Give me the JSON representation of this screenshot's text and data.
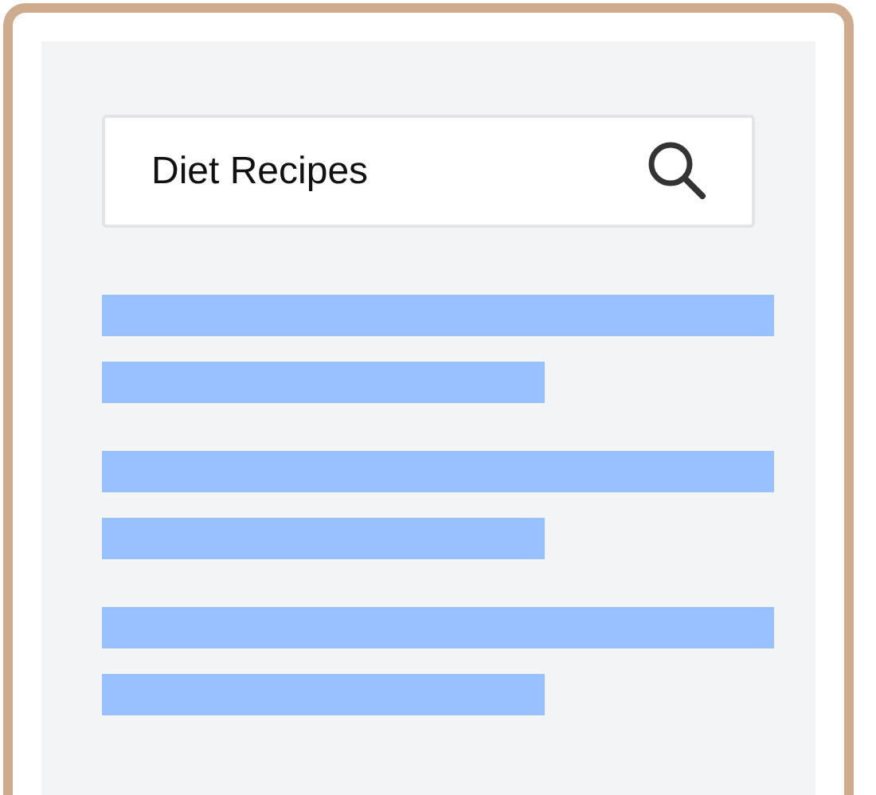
{
  "search": {
    "value": "Diet Recipes"
  },
  "results": [
    {
      "kind": "placeholder"
    },
    {
      "kind": "placeholder"
    },
    {
      "kind": "placeholder"
    }
  ]
}
